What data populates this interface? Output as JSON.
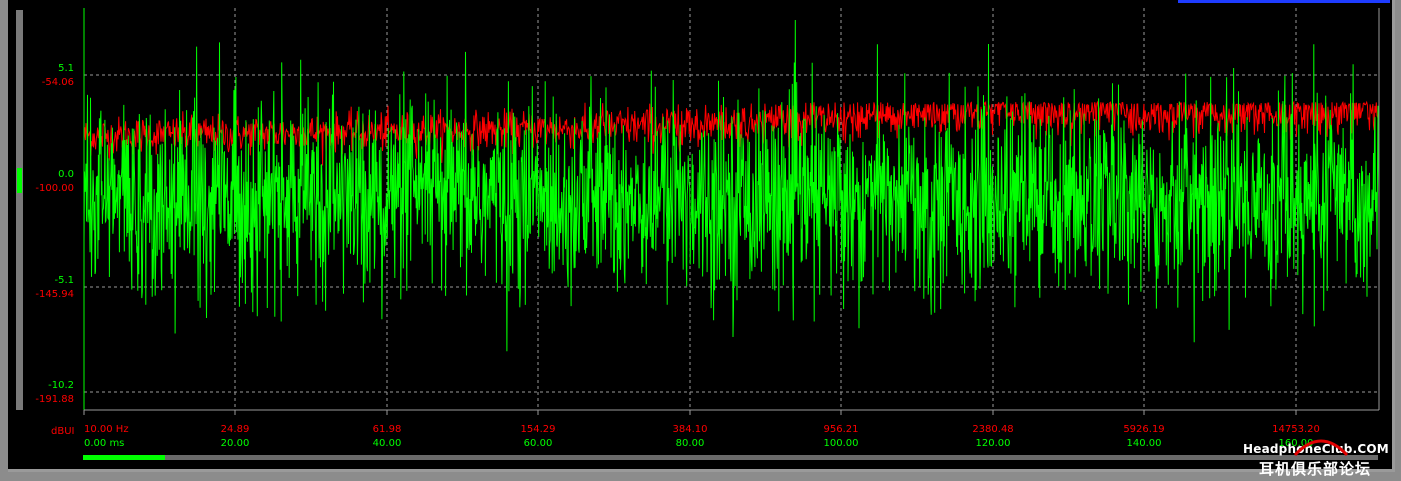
{
  "chart_data": {
    "type": "line",
    "xlabel": "",
    "ylabel": "",
    "grid": true,
    "x_axis_log": true,
    "x_range_hz": [
      10.0,
      36750.0
    ],
    "x_time_range_ms": [
      0,
      180
    ],
    "y_left_green": {
      "ticks": [
        "5.1",
        "0.0",
        "-5.1",
        "-10.2"
      ],
      "range": [
        -11.0,
        9.8
      ]
    },
    "y_left_red": {
      "ticks": [
        "-54.06",
        "-100.00",
        "-145.94",
        "-191.88"
      ],
      "range": [
        -200.0,
        -12.0
      ]
    },
    "x_ticks_hz": [
      "10.00 Hz",
      "24.89",
      "61.98",
      "154.29",
      "384.10",
      "956.21",
      "2380.48",
      "5926.19",
      "14753.20"
    ],
    "x_ticks_ms": [
      "0.00 ms",
      "20.00",
      "40.00",
      "60.00",
      "80.00",
      "100.00",
      "120.00",
      "140.00",
      "160.00"
    ],
    "unit_label": "dBUI",
    "series": [
      {
        "color": "#ff0000",
        "description_axis": "frequency",
        "x_hz": [
          10,
          24.89,
          61.98,
          154.29,
          384.1,
          956.21,
          2380.48,
          5926.19,
          14753.2,
          36700
        ],
        "y_db_mean": [
          -72,
          -71,
          -70,
          -69,
          -67,
          -65,
          -61,
          -61,
          -62,
          -60
        ],
        "y_db_noise_amplitude": [
          8,
          8,
          8,
          8,
          9,
          9,
          10,
          10,
          10,
          10
        ]
      },
      {
        "color": "#00ff00",
        "description_axis": "time",
        "x_ms": [
          0,
          20,
          40,
          60,
          80,
          100,
          120,
          140,
          160,
          180
        ],
        "y_level": [
          0,
          0,
          0,
          0,
          0,
          0,
          0,
          0,
          0,
          0
        ],
        "y_noise_amplitude": [
          3.2,
          3.2,
          3.2,
          3.2,
          3.2,
          3.2,
          3.2,
          3.2,
          3.2,
          3.2
        ],
        "y_peak_amplitude": [
          6.5,
          6.5,
          6.5,
          6.5,
          6.5,
          6.5,
          6.5,
          6.5,
          6.5,
          6.5
        ]
      }
    ]
  },
  "colors": {
    "green": "#00ff00",
    "red": "#ff0000",
    "grid": "#9a9a9a",
    "background": "#000000"
  },
  "watermark": {
    "text": "HeadphoneClub.COM",
    "text_cn": "耳机俱乐部论坛"
  }
}
